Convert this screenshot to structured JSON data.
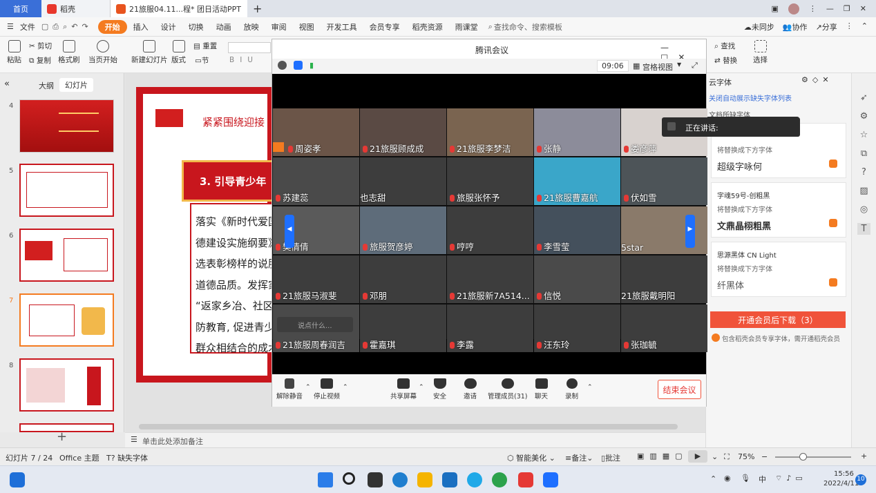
{
  "tabs": {
    "home": "首页",
    "docer": "稻壳",
    "doc": "21旅服04.11...程* 团日活动PPT"
  },
  "menu": {
    "file": "文件",
    "items": [
      "开始",
      "插入",
      "设计",
      "切换",
      "动画",
      "放映",
      "审阅",
      "视图",
      "开发工具",
      "会员专享",
      "稻壳资源",
      "雨课堂"
    ],
    "search": "查找命令、搜索模板",
    "unsync": "未同步",
    "collab": "协作",
    "share": "分享"
  },
  "toolbar": {
    "cut": "剪切",
    "copy": "复制",
    "paste": "粘贴",
    "format_painter": "格式刷",
    "from_current": "当页开始",
    "new_slide": "新建幻灯片",
    "layout": "版式",
    "section": "节",
    "reset": "重置",
    "find": "查找",
    "replace": "替换",
    "select": "选择"
  },
  "left_panel": {
    "tab_outline": "大纲",
    "tab_slides": "幻灯片",
    "numbers": [
      "4",
      "5",
      "6",
      "7",
      "8"
    ],
    "selected_number": "7"
  },
  "slide": {
    "banner": "紧紧围绕迎接",
    "heading": "3. 引导青少年",
    "lines": [
      "落实《新时代爱国",
      "德建设实施纲要》",
      "选表彰榜样的说服",
      "道德品质。发挥家",
      "“返家乡冶、社区",
      "防教育, 促进青少",
      "群众相结合的成木"
    ]
  },
  "meeting": {
    "title": "腾讯会议",
    "timer": "09:06",
    "view_mode": "宫格视图",
    "speaking": "正在讲话:",
    "chat_placeholder": "说点什么...",
    "participants": [
      [
        "周姿孝",
        "21旅服顾成成",
        "21旅服李梦洁",
        "张静",
        "娄彦萍"
      ],
      [
        "苏建蕊",
        "也志甜",
        "旅服张怀予",
        "21旅服曹嘉航",
        "伏如雪"
      ],
      [
        "樊倩倩",
        "旅服贺彦婷",
        "哼哼",
        "李雪莹",
        "5star"
      ],
      [
        "21旅服马淑斐",
        "邓朋",
        "21旅服新7A514...",
        "信悦",
        "21旅服戴明阳"
      ],
      [
        "21旅服周春润吉",
        "霍嘉琪",
        "李露",
        "汪东玲",
        "张珈毓"
      ]
    ],
    "controls": {
      "unmute": "解除静音",
      "stop_video": "停止视频",
      "share_screen": "共享屏幕",
      "security": "安全",
      "invite": "邀请",
      "manage": "管理成员(31)",
      "chat": "聊天",
      "record": "录制",
      "end": "结束会议"
    }
  },
  "right_panel": {
    "header": "云字体",
    "close_display": "关闭自动展示缺失字体列表",
    "missing_label": "文档所缺字体",
    "replace_hint": "将替换成下方字体",
    "fonts": [
      {
        "preview": "超级字咏何"
      },
      {
        "name": "字魂59号-创粗黑",
        "preview": "文鼎晶栩粗黑"
      },
      {
        "name": "思源黑体 CN Light",
        "preview": "纤黑体"
      }
    ],
    "download_btn": "开通会员后下载（3）",
    "note": "包含稻壳会员专享字体，需开通稻壳会员"
  },
  "notes_placeholder": "单击此处添加备注",
  "status": {
    "slide_count": "幻灯片 7 / 24",
    "theme": "Office 主题",
    "missing_font": "缺失字体",
    "beautify": "智能美化",
    "notes": "备注",
    "comments": "批注",
    "zoom": "75%"
  },
  "taskbar": {
    "lang": "中",
    "time": "15:56",
    "date": "2022/4/11",
    "badge": "10"
  },
  "colors": {
    "accent": "#f47b20",
    "red": "#c8161d",
    "meeting_blue": "#1e6fff",
    "download_red": "#f0533a"
  }
}
